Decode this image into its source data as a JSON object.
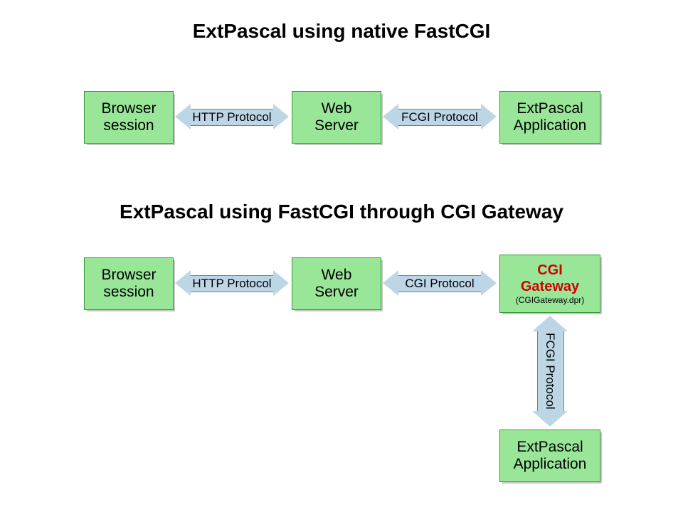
{
  "colors": {
    "box_fill": "#99e699",
    "box_border": "#339933",
    "arrow_fill": "#bcd6e6",
    "arrow_border": "#5b8aa6",
    "shadow": "#c8c8c8",
    "accent_red": "#d40000"
  },
  "titles": {
    "section1": "ExtPascal using native FastCGI",
    "section2": "ExtPascal using FastCGI through CGI Gateway"
  },
  "section1": {
    "boxes": {
      "browser": {
        "line1": "Browser",
        "line2": "session"
      },
      "webserver": {
        "line1": "Web",
        "line2": "Server"
      },
      "app": {
        "line1": "ExtPascal",
        "line2": "Application"
      }
    },
    "arrows": {
      "http": "HTTP Protocol",
      "fcgi": "FCGI Protocol"
    }
  },
  "section2": {
    "boxes": {
      "browser": {
        "line1": "Browser",
        "line2": "session"
      },
      "webserver": {
        "line1": "Web",
        "line2": "Server"
      },
      "gateway": {
        "line1": "CGI",
        "line2": "Gateway",
        "sub": "(CGIGateway.dpr)"
      },
      "app": {
        "line1": "ExtPascal",
        "line2": "Application"
      }
    },
    "arrows": {
      "http": "HTTP Protocol",
      "cgi": "CGI Protocol",
      "fcgi": "FCGI Protocol"
    }
  }
}
